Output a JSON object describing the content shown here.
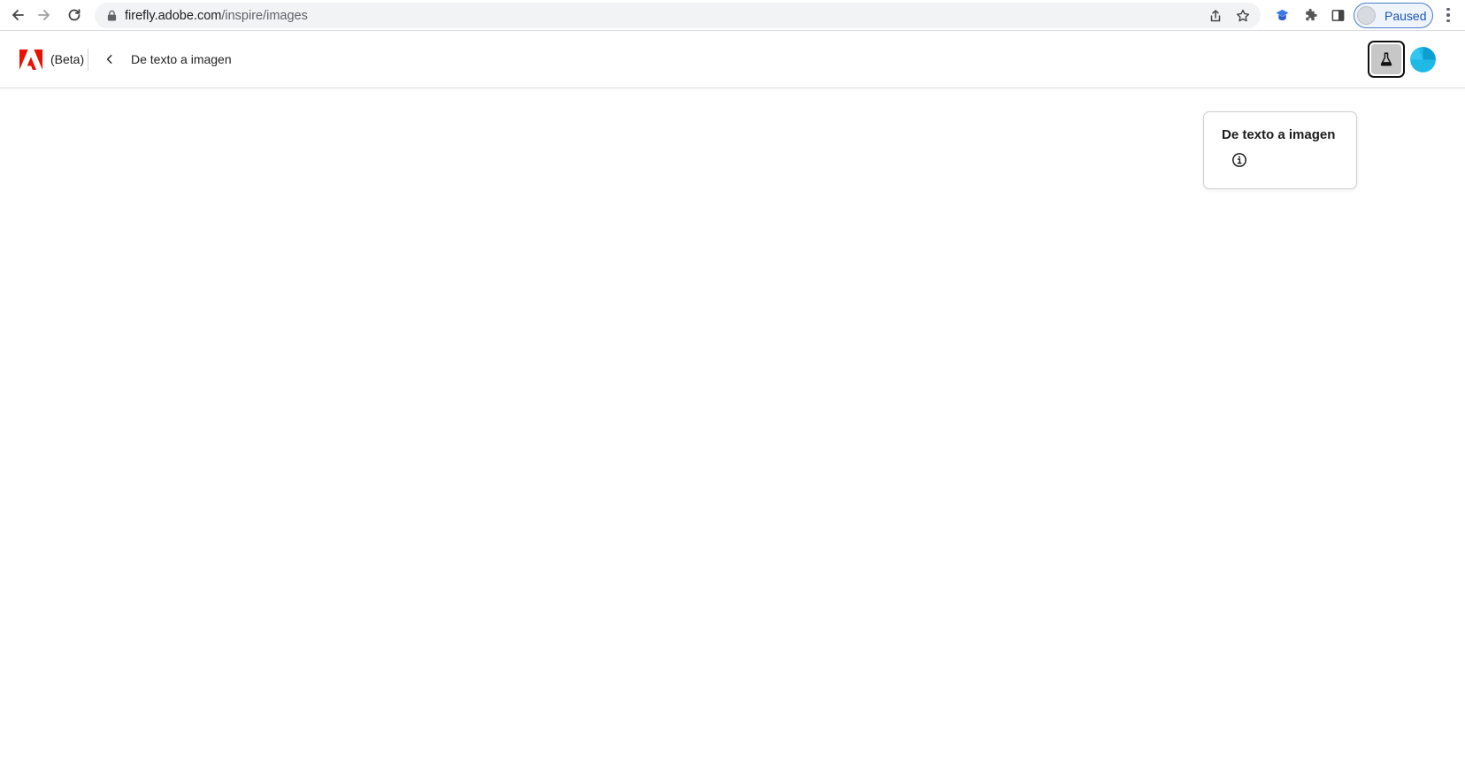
{
  "browser": {
    "url_domain": "firefly.adobe.com",
    "url_path": "/inspire/images",
    "profile_label": "Paused",
    "icons": {
      "back": "arrow-left-icon",
      "forward": "arrow-right-icon",
      "reload": "reload-icon",
      "lock": "lock-icon",
      "share": "share-icon",
      "bookmark": "star-icon",
      "extension_1": "graduation-cap-icon",
      "extensions": "puzzle-icon",
      "side_panel": "side-panel-icon",
      "menu": "kebab-menu-icon"
    }
  },
  "header": {
    "beta_label": "(Beta)",
    "page_title": "De texto a imagen",
    "brand_color": "#eb1000",
    "avatar_color": "#1fb9e6"
  },
  "popover": {
    "title": "De texto a imagen",
    "icon": "info-icon"
  }
}
